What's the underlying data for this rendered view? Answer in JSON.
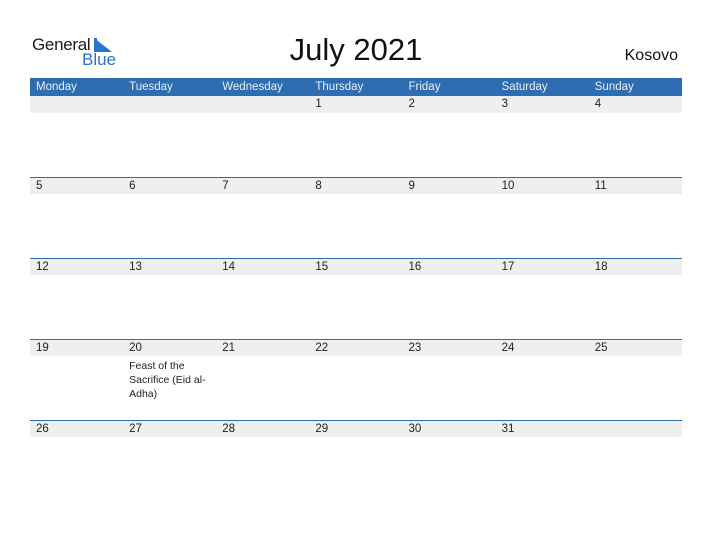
{
  "logo": {
    "word1": "General",
    "word2": "Blue"
  },
  "title": "July 2021",
  "country": "Kosovo",
  "colors": {
    "header_bg": "#2e6db2",
    "band_bg": "#efefef",
    "brand_blue": "#2a76c6"
  },
  "weekdays": [
    "Monday",
    "Tuesday",
    "Wednesday",
    "Thursday",
    "Friday",
    "Saturday",
    "Sunday"
  ],
  "weeks": [
    {
      "days": [
        {
          "n": ""
        },
        {
          "n": ""
        },
        {
          "n": ""
        },
        {
          "n": "1"
        },
        {
          "n": "2"
        },
        {
          "n": "3"
        },
        {
          "n": "4"
        }
      ]
    },
    {
      "days": [
        {
          "n": "5"
        },
        {
          "n": "6"
        },
        {
          "n": "7"
        },
        {
          "n": "8"
        },
        {
          "n": "9"
        },
        {
          "n": "10"
        },
        {
          "n": "11"
        }
      ]
    },
    {
      "days": [
        {
          "n": "12"
        },
        {
          "n": "13"
        },
        {
          "n": "14"
        },
        {
          "n": "15"
        },
        {
          "n": "16"
        },
        {
          "n": "17"
        },
        {
          "n": "18"
        }
      ]
    },
    {
      "days": [
        {
          "n": "19"
        },
        {
          "n": "20",
          "event": "Feast of the Sacrifice (Eid al-Adha)"
        },
        {
          "n": "21"
        },
        {
          "n": "22"
        },
        {
          "n": "23"
        },
        {
          "n": "24"
        },
        {
          "n": "25"
        }
      ]
    },
    {
      "days": [
        {
          "n": "26"
        },
        {
          "n": "27"
        },
        {
          "n": "28"
        },
        {
          "n": "29"
        },
        {
          "n": "30"
        },
        {
          "n": "31"
        },
        {
          "n": ""
        }
      ]
    }
  ]
}
